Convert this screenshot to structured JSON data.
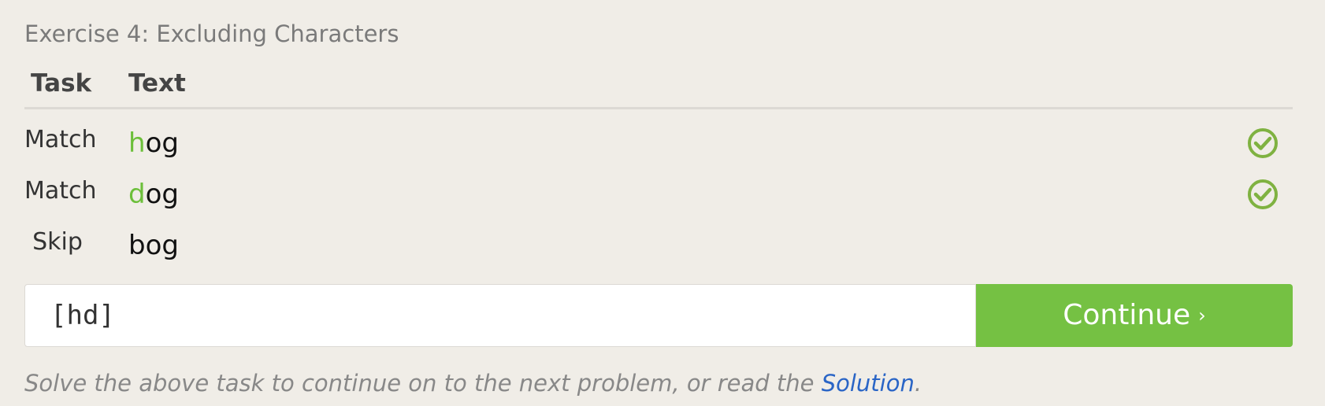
{
  "exercise": {
    "title": "Exercise 4: Excluding Characters",
    "columns": {
      "task": "Task",
      "text": "Text"
    },
    "rows": [
      {
        "task": "Match",
        "match": "h",
        "rest": "og",
        "status_icon": "check-circle-icon"
      },
      {
        "task": "Match",
        "match": "d",
        "rest": "og",
        "status_icon": "check-circle-icon"
      },
      {
        "task": "Skip",
        "match": "",
        "rest": "bog"
      }
    ],
    "input_value": "[hd]",
    "continue_label": "Continue",
    "continue_chevron": "›",
    "hint_prefix": "Solve the above task to continue on to the next problem, or read the ",
    "hint_link": "Solution",
    "hint_suffix": "."
  },
  "colors": {
    "background": "#f0ede7",
    "match_highlight": "#6cbf3a",
    "button": "#75c143",
    "link": "#2a65c6"
  }
}
